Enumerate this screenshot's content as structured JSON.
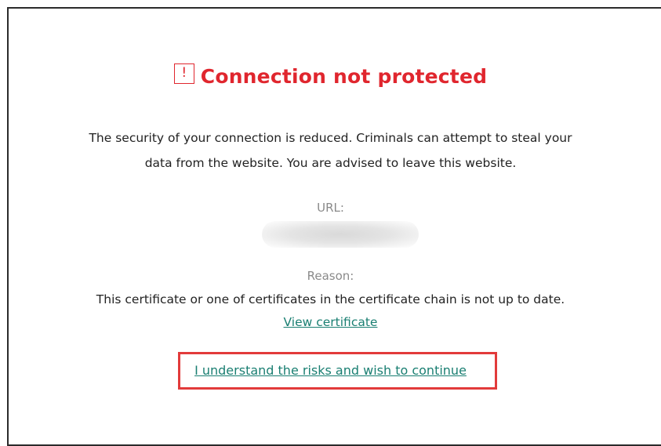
{
  "page": {
    "title": "Connection not protected",
    "warning_icon_glyph": "!",
    "description_line1": "The security of your connection is reduced. Criminals can attempt to steal your",
    "description_line2": "data from the website. You are advised to leave this website.",
    "url_label": "URL:",
    "reason_label": "Reason:",
    "reason_text": "This certificate or one of certificates in the certificate chain is not up to date.",
    "view_certificate_link": "View certificate",
    "continue_link": "I understand the risks and wish to continue"
  },
  "colors": {
    "warning_red": "#e0262e",
    "link_teal": "#1a7f72",
    "highlight_red": "#e23b3b",
    "label_gray": "#8a8a8a"
  },
  "icons": {
    "warning": "warning-exclamation-icon"
  }
}
